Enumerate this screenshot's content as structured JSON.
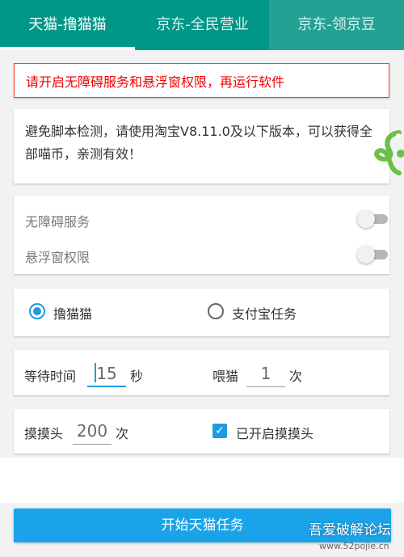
{
  "tabs": [
    {
      "label": "天猫-撸猫猫",
      "selected": true
    },
    {
      "label": "京东-全民营业",
      "selected": false
    },
    {
      "label": "京东-领京豆",
      "selected": false
    }
  ],
  "warning": "请开启无障碍服务和悬浮窗权限，再运行软件",
  "note": "避免脚本检测，请使用淘宝V8.11.0及以下版本，可以获得全部喵币，亲测有效！",
  "switches": [
    {
      "label": "无障碍服务",
      "on": false
    },
    {
      "label": "悬浮窗权限",
      "on": false
    }
  ],
  "modes": [
    {
      "label": "撸猫猫",
      "selected": true
    },
    {
      "label": "支付宝任务",
      "selected": false
    }
  ],
  "timing": {
    "wait_label": "等待时间",
    "wait_value": "15",
    "wait_unit": "秒",
    "feed_label": "喂猫",
    "feed_value": "1",
    "feed_unit": "次"
  },
  "touch": {
    "label": "摸摸头",
    "value": "200",
    "unit": "次",
    "checkbox_label": "已开启摸摸头",
    "checked": true
  },
  "start_button": "开始天猫任务",
  "watermark": {
    "title": "吾爱破解论坛",
    "url": "www.52pojie.cn"
  },
  "colors": {
    "tab_bar": "#009688",
    "accent": "#1e9be0",
    "warning": "#f00000",
    "logo": "#6cc04a"
  }
}
